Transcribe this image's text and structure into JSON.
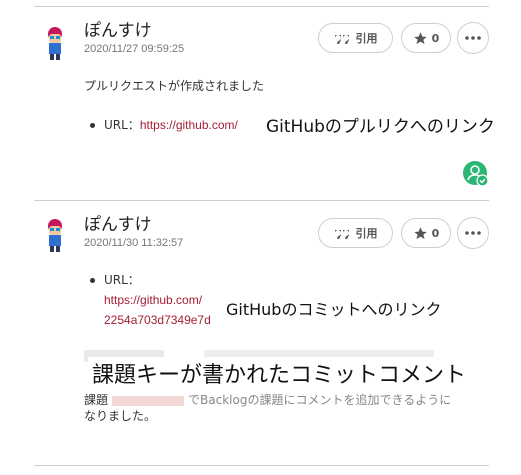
{
  "comments": [
    {
      "author": "ぽんすけ",
      "date": "2020/11/27 09:59:25",
      "quote_label": "引用",
      "star_count": "0",
      "text": "プルリクエストが作成されました",
      "url_label": "URL：",
      "url": "https://github.com/",
      "overlay": "GitHubのプルリクへのリンク"
    },
    {
      "author": "ぽんすけ",
      "date": "2020/11/30 11:32:57",
      "quote_label": "引用",
      "star_count": "0",
      "url_label": "URL：",
      "url": "https://github.com/",
      "url_tail": "2254a703d7349e7d",
      "overlay_link": "GitHubのコミットへのリンク",
      "overlay_key": "課題キーが書かれたコミットコメント",
      "footer_line1": "課題",
      "footer_line1_rest": "でBacklogの課題にコメントを追加できるように",
      "footer_line2": "なりました。"
    }
  ],
  "colors": {
    "link": "#a41e34",
    "status_green": "#2bb673"
  }
}
